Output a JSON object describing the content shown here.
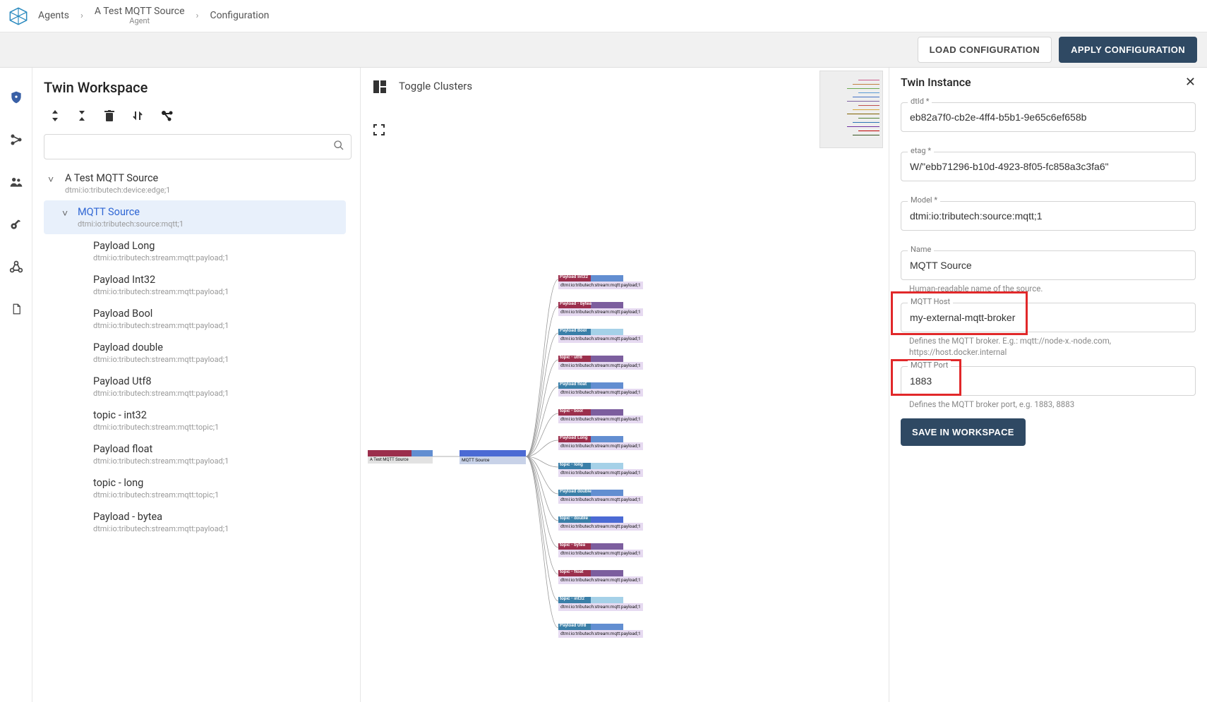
{
  "breadcrumb": {
    "item1": "Agents",
    "item2": "A Test MQTT Source",
    "item2_sub": "Agent",
    "item3": "Configuration"
  },
  "actions": {
    "load": "LOAD CONFIGURATION",
    "apply": "APPLY CONFIGURATION"
  },
  "workspace": {
    "title": "Twin Workspace",
    "search_placeholder": "",
    "tree": {
      "root": {
        "title": "A Test MQTT Source",
        "sub": "dtmi:io:tributech:device:edge;1"
      },
      "selected": {
        "title": "MQTT Source",
        "sub": "dtmi:io:tributech:source:mqtt;1"
      },
      "children": [
        {
          "title": "Payload Long",
          "sub": "dtmi:io:tributech:stream:mqtt:payload;1"
        },
        {
          "title": "Payload Int32",
          "sub": "dtmi:io:tributech:stream:mqtt:payload;1"
        },
        {
          "title": "Payload Bool",
          "sub": "dtmi:io:tributech:stream:mqtt:payload;1"
        },
        {
          "title": "Payload double",
          "sub": "dtmi:io:tributech:stream:mqtt:payload;1"
        },
        {
          "title": "Payload Utf8",
          "sub": "dtmi:io:tributech:stream:mqtt:payload;1"
        },
        {
          "title": "topic - int32",
          "sub": "dtmi:io:tributech:stream:mqtt:topic;1"
        },
        {
          "title": "Payload float",
          "sub": "dtmi:io:tributech:stream:mqtt:payload;1"
        },
        {
          "title": "topic - long",
          "sub": "dtmi:io:tributech:stream:mqtt:topic;1"
        },
        {
          "title": "Payload - bytea",
          "sub": "dtmi:io:tributech:stream:mqtt:payload;1"
        }
      ]
    }
  },
  "center": {
    "toggle_label": "Toggle Clusters",
    "root_label": "A Test MQTT Source",
    "src_label": "MQTT Source",
    "streams": [
      {
        "label": "Payload Int32",
        "c1": "#9b2e4c",
        "c2": "#628ed1"
      },
      {
        "label": "Payload - bytea",
        "c1": "#9b2e4c",
        "c2": "#7c5e9e"
      },
      {
        "label": "Payload Bool",
        "c1": "#3a7fa8",
        "c2": "#a5d1e8"
      },
      {
        "label": "topic - utf8",
        "c1": "#9b2e4c",
        "c2": "#7c5e9e"
      },
      {
        "label": "Payload float",
        "c1": "#3a7fa8",
        "c2": "#628ed1"
      },
      {
        "label": "topic - bool",
        "c1": "#9b2e4c",
        "c2": "#7c5e9e"
      },
      {
        "label": "Payload Long",
        "c1": "#9b2e4c",
        "c2": "#628ed1"
      },
      {
        "label": "topic - long",
        "c1": "#3a7fa8",
        "c2": "#a5d1e8"
      },
      {
        "label": "Payload double",
        "c1": "#3a7fa8",
        "c2": "#628ed1"
      },
      {
        "label": "topic - double",
        "c1": "#3a7fa8",
        "c2": "#4b6ad4"
      },
      {
        "label": "topic - bytea",
        "c1": "#9b2e4c",
        "c2": "#7c5e9e"
      },
      {
        "label": "topic - float",
        "c1": "#9b2e4c",
        "c2": "#7c5e9e"
      },
      {
        "label": "topic - int32",
        "c1": "#3a7fa8",
        "c2": "#a5d1e8"
      },
      {
        "label": "Payload Utf8",
        "c1": "#3a7fa8",
        "c2": "#628ed1"
      }
    ]
  },
  "instance": {
    "title": "Twin Instance",
    "dtid_label": "dtId *",
    "dtid": "eb82a7f0-cb2e-4ff4-b5b1-9e65c6ef658b",
    "etag_label": "etag *",
    "etag": "W/\"ebb71296-b10d-4923-8f05-fc858a3c3fa6\"",
    "model_label": "Model *",
    "model": "dtmi:io:tributech:source:mqtt;1",
    "name_label": "Name",
    "name": "MQTT Source",
    "name_hint": "Human-readable name of the source.",
    "host_label": "MQTT Host",
    "host": "my-external-mqtt-broker",
    "host_hint": "Defines the MQTT broker. E.g.: mqtt://node-x.-node.com, https://host.docker.internal",
    "port_label": "MQTT Port",
    "port": "1883",
    "port_hint": "Defines the MQTT broker port, e.g. 1883, 8883",
    "save": "SAVE IN WORKSPACE"
  }
}
